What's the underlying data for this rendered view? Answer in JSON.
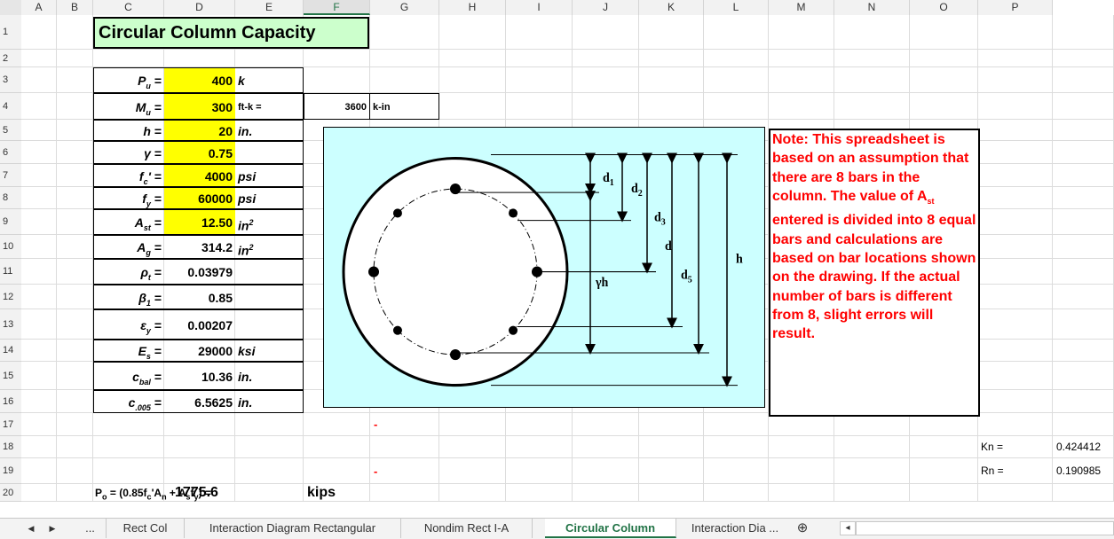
{
  "columns": [
    "A",
    "B",
    "C",
    "D",
    "E",
    "F",
    "G",
    "H",
    "I",
    "J",
    "K",
    "L",
    "M",
    "N",
    "O",
    "P"
  ],
  "rows": [
    "1",
    "2",
    "3",
    "4",
    "5",
    "6",
    "7",
    "8",
    "9",
    "10",
    "11",
    "12",
    "13",
    "14",
    "15",
    "16",
    "17",
    "18",
    "19",
    "20"
  ],
  "title": "Circular Column Capacity",
  "inputs": [
    {
      "sym": "P",
      "sub": "u",
      "eq": "=",
      "value": "400",
      "unit": "k"
    },
    {
      "sym": "M",
      "sub": "u",
      "eq": "=",
      "value": "300",
      "unit": "ft-k  =",
      "extra_value": "3600",
      "extra_unit": "k-in"
    },
    {
      "sym": "h",
      "sub": "",
      "eq": "=",
      "value": "20",
      "unit": "in."
    },
    {
      "sym": "γ",
      "sub": "",
      "eq": "=",
      "value": "0.75",
      "unit": ""
    },
    {
      "sym": "f",
      "sub": "c",
      "prime": "'",
      "eq": "=",
      "value": "4000",
      "unit": "psi"
    },
    {
      "sym": "f",
      "sub": "y",
      "eq": "=",
      "value": "60000",
      "unit": "psi"
    },
    {
      "sym": "A",
      "sub": "st",
      "eq": "=",
      "value": "12.50",
      "unit": "in",
      "unit_sup": "2"
    }
  ],
  "outputs": [
    {
      "sym": "A",
      "sub": "g",
      "eq": "=",
      "value": "314.2",
      "unit": "in",
      "unit_sup": "2"
    },
    {
      "sym": "ρ",
      "sub": "t",
      "eq": "=",
      "value": "0.03979",
      "unit": ""
    },
    {
      "sym": "β",
      "sub": "1",
      "eq": "=",
      "value": "0.85",
      "unit": ""
    },
    {
      "sym": "ε",
      "sub": "y",
      "eq": "=",
      "value": "0.00207",
      "unit": ""
    },
    {
      "sym": "E",
      "sub": "s",
      "eq": "=",
      "value": "29000",
      "unit": "ksi"
    },
    {
      "sym": "c",
      "sub": "bal",
      "eq": "=",
      "value": "10.36",
      "unit": "in."
    },
    {
      "sym": "c",
      "sub": ".005",
      "eq": "=",
      "value": "6.5625",
      "unit": "in."
    }
  ],
  "diagram": {
    "labels": {
      "d1": "d",
      "d1_sub": "1",
      "d2": "d",
      "d2_sub": "2",
      "d3": "d",
      "d3_sub": "3",
      "d": "d",
      "d5": "d",
      "d5_sub": "5",
      "h": "h",
      "gh": "γh"
    }
  },
  "note": {
    "line1": "Note:  This spreadsheet is based on an assumption that there are 8 bars in the column.  The value of ",
    "ast": "A",
    "ast_sub": "st",
    "line2": " entered is divided into 8 equal bars and calculations are based on bar locations shown on the drawing. If the actual number of bars is different from 8, slight errors will result."
  },
  "dashes": [
    "-",
    "-"
  ],
  "side_values": [
    {
      "label": "Kn =",
      "value": "0.424412"
    },
    {
      "label": "Rn =",
      "value": "0.190985"
    }
  ],
  "po": {
    "label_pre": "P",
    "label_pre_sub": "o",
    "label_mid": " = (0.85f",
    "fc_sub": "c",
    "label_mid2": "'A",
    "an_sub": "n",
    "label_mid3": " + A",
    "as_sub": "s",
    "label_mid4": "f",
    "fy_sub": "y",
    "label_end": ") =",
    "value": "1775.6",
    "unit": "kips"
  },
  "tabs": {
    "ellipsis_left": "...",
    "items": [
      "Rect Col",
      "Interaction Diagram Rectangular",
      "Nondim Rect I-A",
      "Circular Column",
      "Interaction Dia ..."
    ],
    "active": "Circular Column",
    "add": "⊕",
    "prev": "◀",
    "next": "▶",
    "scroll_left": "◂"
  },
  "colors": {
    "yellow": "#ffff00",
    "title_bg": "#ccffcc",
    "diagram_bg": "#ccffff",
    "note_text": "#ff0000",
    "accent": "#217346"
  }
}
